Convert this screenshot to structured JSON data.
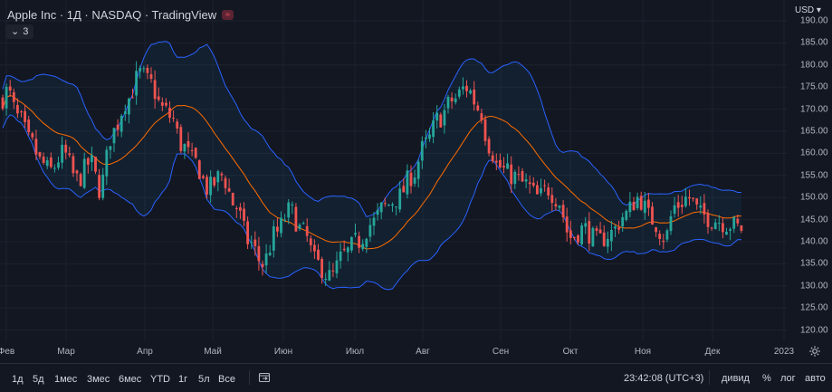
{
  "header": {
    "symbol_title": "Apple Inc · 1Д · NASDAQ · TradingView",
    "badge": "≈",
    "indicator_count": "3",
    "indicator_chevron": "⌄"
  },
  "currency": "USD",
  "colors": {
    "background": "#131722",
    "up": "#26a69a",
    "down": "#ef5350",
    "band": "#2962ff",
    "basis": "#ff6d00"
  },
  "chart_data": {
    "type": "candlestick",
    "indicator": "Bollinger Bands",
    "ylim": [
      117,
      193
    ],
    "y_ticks": [
      "190.00",
      "185.00",
      "180.00",
      "175.00",
      "170.00",
      "165.00",
      "160.00",
      "155.00",
      "150.00",
      "145.00",
      "140.00",
      "135.00",
      "130.00",
      "125.00",
      "120.00"
    ],
    "x_ticks": [
      "Фев",
      "Мар",
      "Апр",
      "Май",
      "Июн",
      "Июл",
      "Авг",
      "Сен",
      "Окт",
      "Ноя",
      "Дек",
      "2023"
    ],
    "anchors": [
      [
        0,
        172
      ],
      [
        8,
        174
      ],
      [
        20,
        168
      ],
      [
        35,
        162
      ],
      [
        45,
        158
      ],
      [
        55,
        156
      ],
      [
        70,
        160
      ],
      [
        85,
        154
      ],
      [
        100,
        158
      ],
      [
        110,
        152
      ],
      [
        125,
        165
      ],
      [
        140,
        172
      ],
      [
        155,
        178
      ],
      [
        165,
        176
      ],
      [
        180,
        170
      ],
      [
        190,
        168
      ],
      [
        200,
        162
      ],
      [
        215,
        158
      ],
      [
        230,
        152
      ],
      [
        245,
        155
      ],
      [
        260,
        148
      ],
      [
        275,
        140
      ],
      [
        290,
        135
      ],
      [
        305,
        142
      ],
      [
        320,
        147
      ],
      [
        335,
        142
      ],
      [
        350,
        135
      ],
      [
        365,
        132
      ],
      [
        380,
        137
      ],
      [
        395,
        140
      ],
      [
        410,
        144
      ],
      [
        425,
        148
      ],
      [
        440,
        150
      ],
      [
        455,
        155
      ],
      [
        470,
        162
      ],
      [
        485,
        168
      ],
      [
        500,
        172
      ],
      [
        515,
        175
      ],
      [
        530,
        170
      ],
      [
        540,
        162
      ],
      [
        550,
        157
      ],
      [
        565,
        155
      ],
      [
        580,
        153
      ],
      [
        595,
        150
      ],
      [
        605,
        152
      ],
      [
        615,
        150
      ],
      [
        630,
        141
      ],
      [
        645,
        143
      ],
      [
        660,
        140
      ],
      [
        675,
        142
      ],
      [
        690,
        146
      ],
      [
        705,
        150
      ],
      [
        720,
        145
      ],
      [
        735,
        141
      ],
      [
        745,
        148
      ],
      [
        760,
        150
      ],
      [
        775,
        146
      ],
      [
        790,
        145
      ],
      [
        805,
        144
      ],
      [
        818,
        143
      ]
    ]
  },
  "bottom_bar": {
    "ranges": [
      "1д",
      "5д",
      "1мес",
      "3мес",
      "6мес",
      "YTD",
      "1г",
      "5л",
      "Все"
    ],
    "clock": "23:42:08 (UTC+3)",
    "options": [
      "дивид",
      "%",
      "лог",
      "авто"
    ]
  }
}
